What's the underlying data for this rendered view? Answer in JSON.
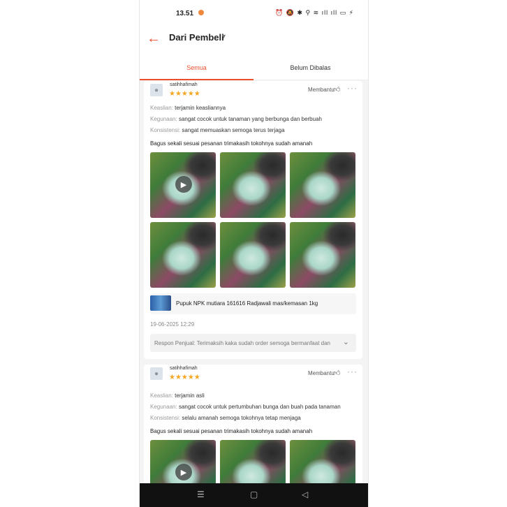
{
  "status_bar": {
    "time": "13.51",
    "icons": "⏰ 🔕 ✱ ⚲ ≋ ıll ıll ▭ ⚡"
  },
  "header": {
    "back_icon": "arrow-left-icon",
    "title": "Dari Pembeli",
    "dropdown_icon": "▼"
  },
  "tabs": [
    {
      "label": "Semua",
      "active": true
    },
    {
      "label": "Belum Dibalas",
      "active": false
    }
  ],
  "accent_color": "#ee4d2d",
  "reviews": [
    {
      "username": "satihhafimah",
      "rating": 5,
      "stars": "★★★★★",
      "helpful_label": "Membantu",
      "attributes": [
        {
          "key": "Keaslian:",
          "value": "terjamin keasliannya"
        },
        {
          "key": "Kegunaan:",
          "value": "sangat cocok untuk tanaman yang berbunga dan berbuah"
        },
        {
          "key": "Konsistensi:",
          "value": "sangat memuaskan semoga terus terjaga"
        }
      ],
      "comment": "Bagus sekali sesuai pesanan trimakasih tokohnya sudah amanah",
      "product_name": "Pupuk NPK mutiara 161616 Radjawali mas/kemasan 1kg",
      "date": "19-06-2025 12:29",
      "seller_response": "Respon Penjual: Terimaksih kaka sudah order semoga bermanfaat dan"
    },
    {
      "username": "satihhafimah",
      "rating": 5,
      "stars": "★★★★★",
      "helpful_label": "Membantu",
      "attributes": [
        {
          "key": "Keaslian:",
          "value": "terjamin asli"
        },
        {
          "key": "Kegunaan:",
          "value": "sangat cocok untuk pertumbuhan bunga dan buah pada tanaman"
        },
        {
          "key": "Konsistensi:",
          "value": "selalu amanah semoga tokohnya tetap menjaga"
        }
      ],
      "comment": "Bagus sekali sesuai pesanan trimakasih tokohnya sudah amanah"
    }
  ],
  "nav_bar": {
    "menu": "☰",
    "home": "▢",
    "back": "◁"
  }
}
